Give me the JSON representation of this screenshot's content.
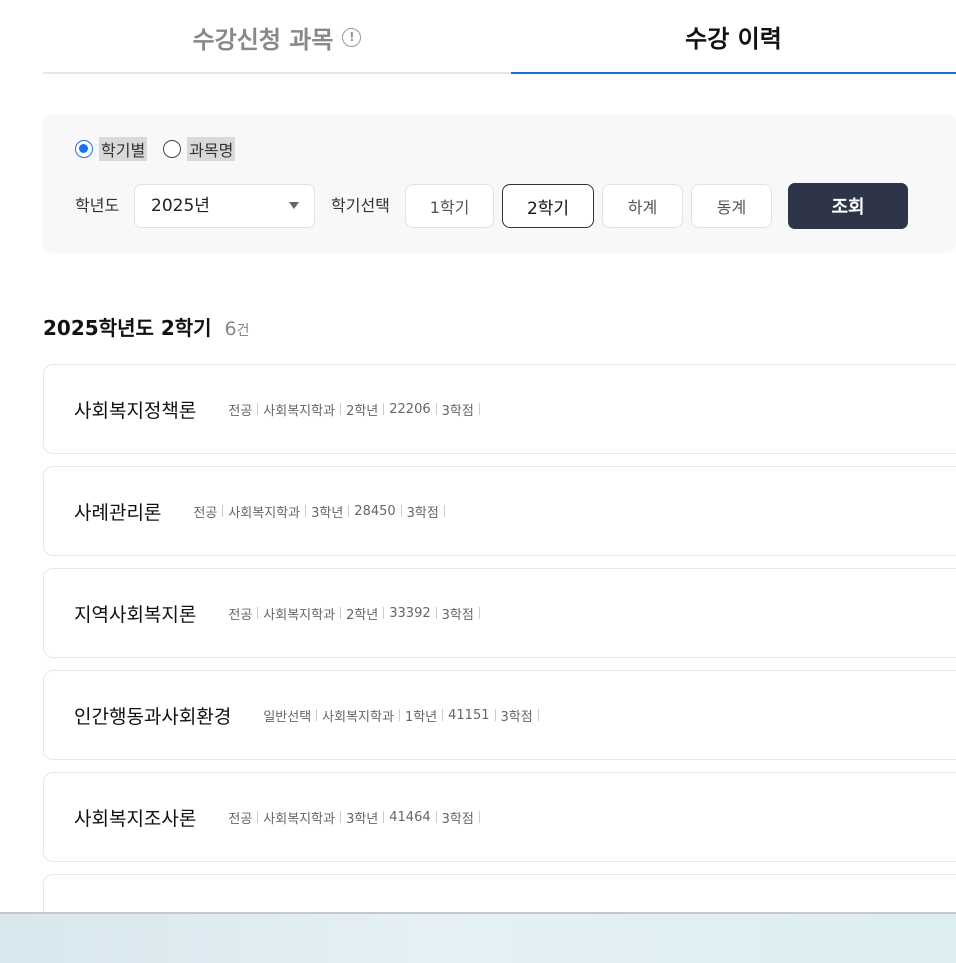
{
  "tabs": {
    "registration": "수강신청 과목",
    "history": "수강 이력"
  },
  "filter": {
    "radio_by_semester": "학기별",
    "radio_by_course": "과목명",
    "year_label": "학년도",
    "year_value": "2025년",
    "semester_label": "학기선택",
    "semesters": [
      "1학기",
      "2학기",
      "하계",
      "동계"
    ],
    "search_label": "조회"
  },
  "result": {
    "title": "2025학년도 2학기",
    "count": "6",
    "count_unit": "건"
  },
  "courses": [
    {
      "name": "사회복지정책론",
      "type": "전공",
      "dept": "사회복지학과",
      "grade": "2학년",
      "code": "22206",
      "credit": "3학점"
    },
    {
      "name": "사례관리론",
      "type": "전공",
      "dept": "사회복지학과",
      "grade": "3학년",
      "code": "28450",
      "credit": "3학점"
    },
    {
      "name": "지역사회복지론",
      "type": "전공",
      "dept": "사회복지학과",
      "grade": "2학년",
      "code": "33392",
      "credit": "3학점"
    },
    {
      "name": "인간행동과사회환경",
      "type": "일반선택",
      "dept": "사회복지학과",
      "grade": "1학년",
      "code": "41151",
      "credit": "3학점"
    },
    {
      "name": "사회복지조사론",
      "type": "전공",
      "dept": "사회복지학과",
      "grade": "3학년",
      "code": "41464",
      "credit": "3학점"
    }
  ]
}
